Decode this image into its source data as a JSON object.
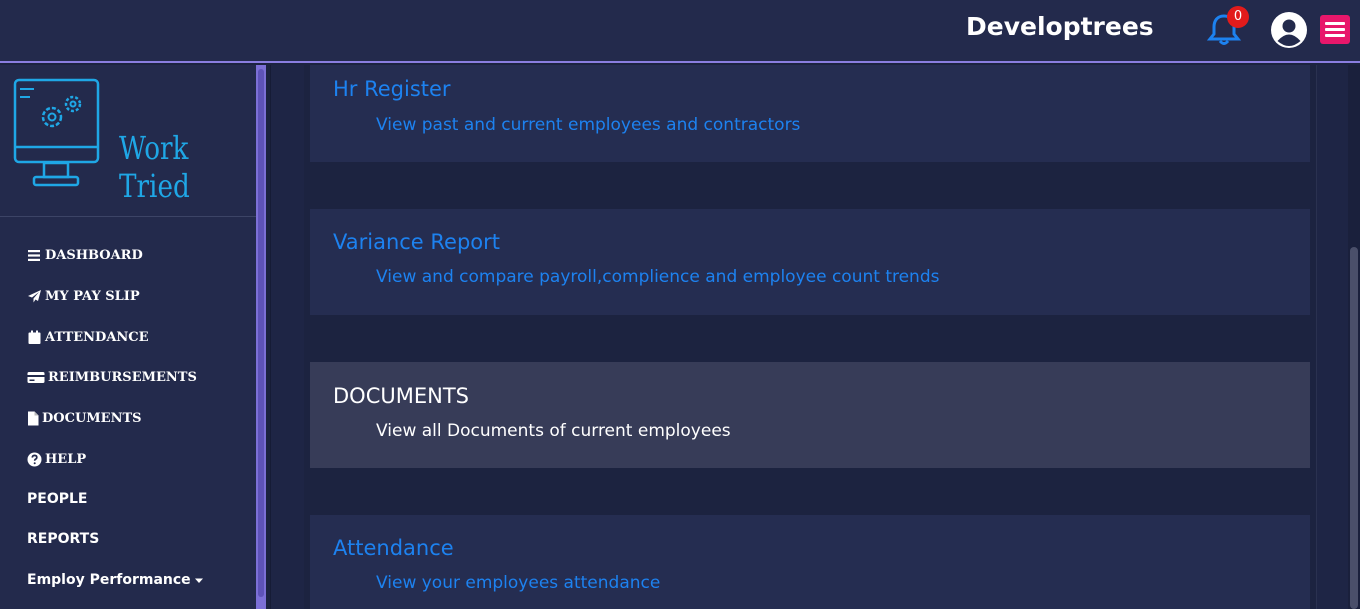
{
  "header": {
    "brand": "Developtrees",
    "notification_count": "0"
  },
  "sidebar": {
    "logo_text": "Work Tried",
    "items": [
      {
        "label": "DASHBOARD",
        "icon": "bars-icon"
      },
      {
        "label": "MY PAY SLIP",
        "icon": "paper-plane-icon"
      },
      {
        "label": "ATTENDANCE",
        "icon": "calendar-icon"
      },
      {
        "label": "REIMBURSEMENTS",
        "icon": "credit-card-icon"
      },
      {
        "label": "DOCUMENTS",
        "icon": "file-icon"
      },
      {
        "label": "HELP",
        "icon": "question-circle-icon"
      },
      {
        "label": "PEOPLE"
      },
      {
        "label": "REPORTS"
      },
      {
        "label": "Employ Performance",
        "icon": "caret-down-icon"
      }
    ]
  },
  "main": {
    "cards": [
      {
        "title": "Hr Register",
        "description": "View past and current employees and contractors"
      },
      {
        "title": "Variance Report",
        "description": "View and compare payroll,complience and employee count trends"
      },
      {
        "title": "DOCUMENTS",
        "description": "View all Documents of current employees"
      },
      {
        "title": "Attendance",
        "description": "View your employees attendance"
      }
    ]
  },
  "colors": {
    "background": "#1c2340",
    "panel": "#232a4c",
    "accent_purple": "#8a7ee0",
    "link_blue": "#1d82f0",
    "menu_pink": "#e8176b",
    "badge_red": "#e21b1b"
  }
}
